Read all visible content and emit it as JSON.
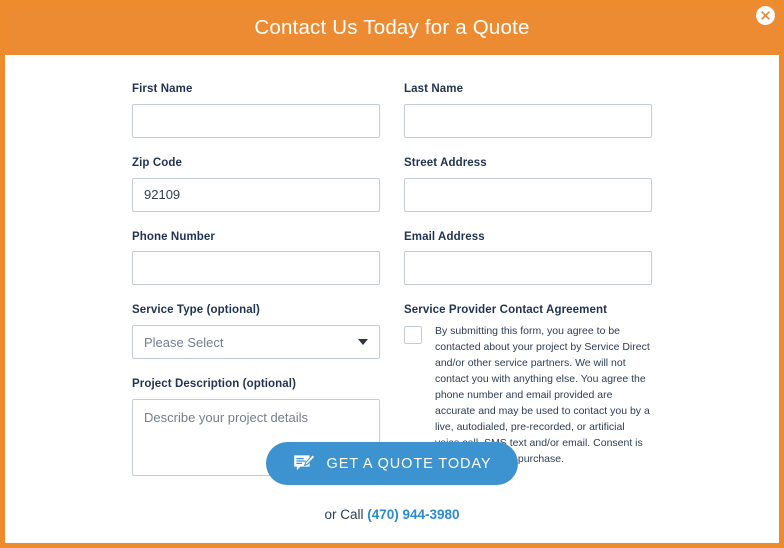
{
  "modal": {
    "title": "Contact Us Today for a Quote",
    "close_label": "×",
    "header_color": "#ed8b33",
    "border_color": "#ee8b2d",
    "accent_blue": "#3d92d0"
  },
  "form": {
    "fields": {
      "first_name": {
        "label": "First Name",
        "value": "",
        "placeholder": ""
      },
      "last_name": {
        "label": "Last Name",
        "value": "",
        "placeholder": ""
      },
      "zip_code": {
        "label": "Zip Code",
        "value": "92109",
        "placeholder": ""
      },
      "street_address": {
        "label": "Street Address",
        "value": "",
        "placeholder": ""
      },
      "phone_number": {
        "label": "Phone Number",
        "value": "",
        "placeholder": ""
      },
      "email_address": {
        "label": "Email Address",
        "value": "",
        "placeholder": ""
      },
      "service_type": {
        "label": "Service Type (optional)",
        "selected": "Please Select",
        "options": [
          "Please Select"
        ]
      },
      "project_description": {
        "label": "Project Description (optional)",
        "value": "",
        "placeholder": "Describe your project details"
      }
    },
    "agreement": {
      "label": "Service Provider Contact Agreement",
      "checked": false,
      "text": "By submitting this form, you agree to be contacted about your project by Service Direct and/or other service partners. We will not contact you with anything else. You agree the phone number and email provided are accurate and may be used to contact you by a live, autodialed, pre-recorded, or artificial voice call, SMS text and/or email. Consent is not a condition of purchase."
    }
  },
  "footer": {
    "cta_label": "GET A QUOTE TODAY",
    "cta_icon": "message-edit-icon",
    "call_prefix": "or Call ",
    "phone": "(470) 944-3980"
  }
}
